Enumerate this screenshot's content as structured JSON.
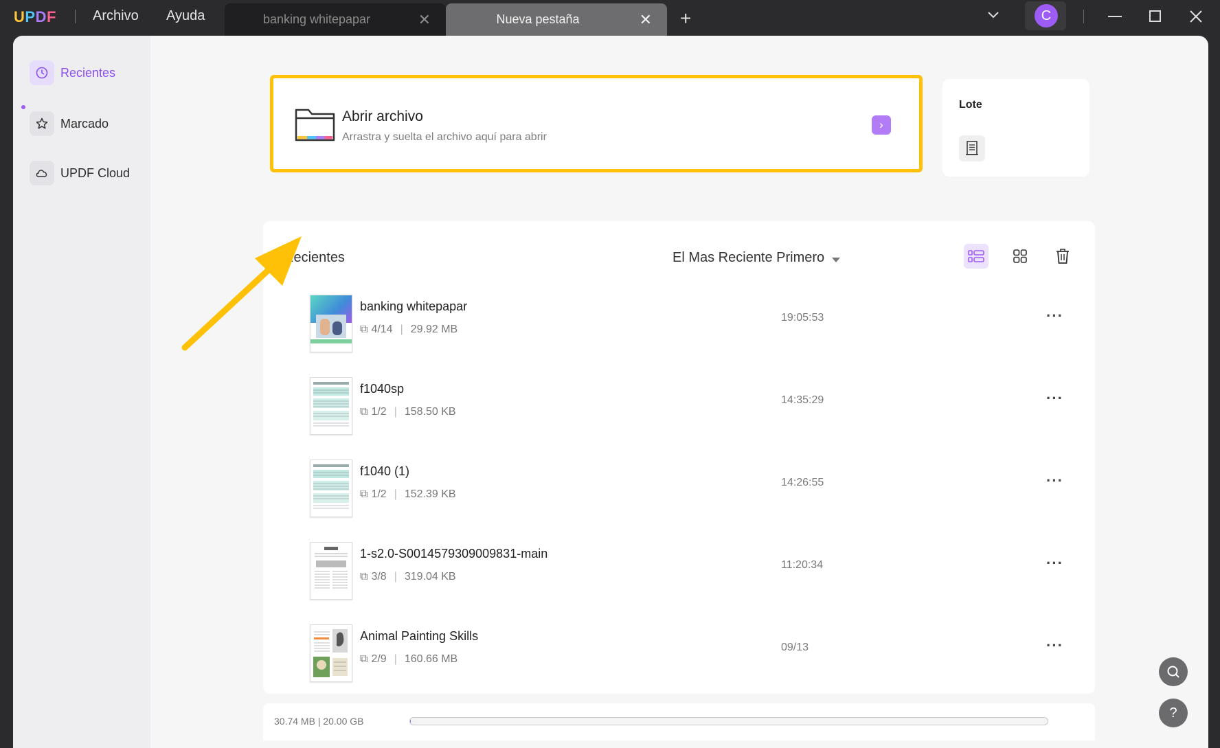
{
  "app": {
    "logo": [
      "U",
      "P",
      "D",
      "F"
    ]
  },
  "menu": {
    "file": "Archivo",
    "help": "Ayuda"
  },
  "tabs": [
    {
      "label": "banking whitepapar",
      "active": false
    },
    {
      "label": "Nueva pestaña",
      "active": true
    }
  ],
  "user": {
    "initial": "C"
  },
  "sidebar": {
    "items": [
      {
        "label": "Recientes",
        "icon": "clock-icon",
        "active": true
      },
      {
        "label": "Marcado",
        "icon": "star-icon",
        "active": false
      },
      {
        "label": "UPDF Cloud",
        "icon": "cloud-icon",
        "active": false
      }
    ]
  },
  "open_card": {
    "title": "Abrir archivo",
    "subtitle": "Arrastra y suelta el archivo aquí para abrir",
    "highlight_color": "#ffc107"
  },
  "batch": {
    "label": "Lote"
  },
  "recent": {
    "title": "Recientes",
    "sort_label": "El Mas Reciente Primero",
    "files": [
      {
        "name": "banking whitepapar",
        "pages": "4/14",
        "size": "29.92 MB",
        "time": "19:05:53"
      },
      {
        "name": "f1040sp",
        "pages": "1/2",
        "size": "158.50 KB",
        "time": "14:35:29"
      },
      {
        "name": "f1040 (1)",
        "pages": "1/2",
        "size": "152.39 KB",
        "time": "14:26:55"
      },
      {
        "name": "1-s2.0-S0014579309009831-main",
        "pages": "3/8",
        "size": "319.04 KB",
        "time": "11:20:34"
      },
      {
        "name": "Animal Painting Skills",
        "pages": "2/9",
        "size": "160.66 MB",
        "time": "09/13"
      }
    ]
  },
  "storage": {
    "label": "30.74 MB | 20.00 GB",
    "used_fraction": 0.0015
  },
  "colors": {
    "accent": "#9d5cf5",
    "highlight": "#ffc107",
    "titlebar": "#2b2b2d"
  }
}
